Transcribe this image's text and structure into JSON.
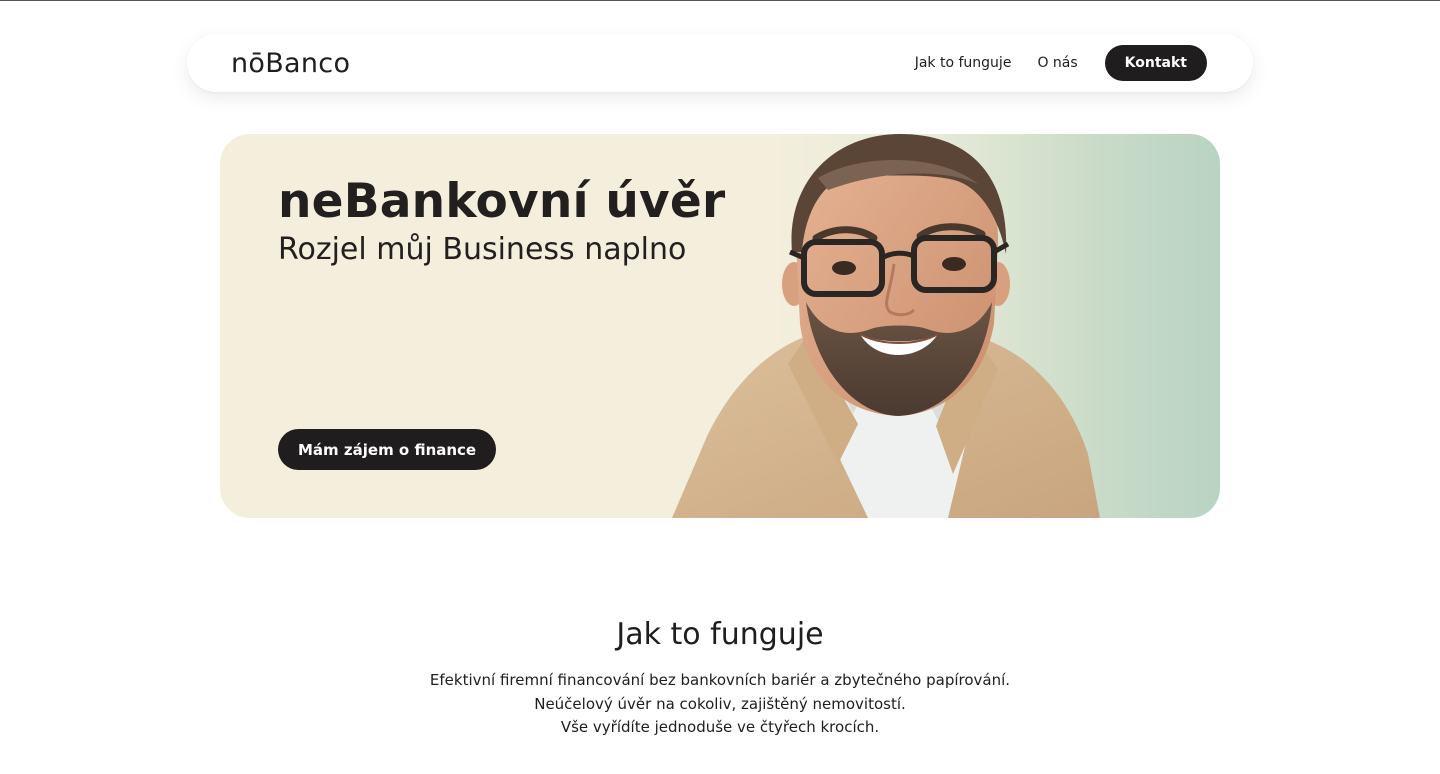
{
  "header": {
    "logo": "nōBanco",
    "nav": [
      {
        "label": "Jak to funguje"
      },
      {
        "label": "O nás"
      }
    ],
    "contact_label": "Kontakt"
  },
  "hero": {
    "title": "neBankovní úvěr",
    "subtitle": "Rozjel můj Business naplno",
    "cta_label": "Mám zájem o finance",
    "image": "smiling man with glasses and beige blazer"
  },
  "section": {
    "title": "Jak to funguje",
    "lines": [
      "Efektivní firemní financování bez bankovních bariér a zbytečného papírování.",
      "Neúčelový úvěr na cokoliv, zajištěný nemovitostí.",
      "Vše vyřídíte jednoduše ve čtyřech krocích."
    ]
  },
  "colors": {
    "dark": "#1f1d1d",
    "hero_bg": "#f4eedc",
    "hero_accent": "#b9d3c3"
  }
}
